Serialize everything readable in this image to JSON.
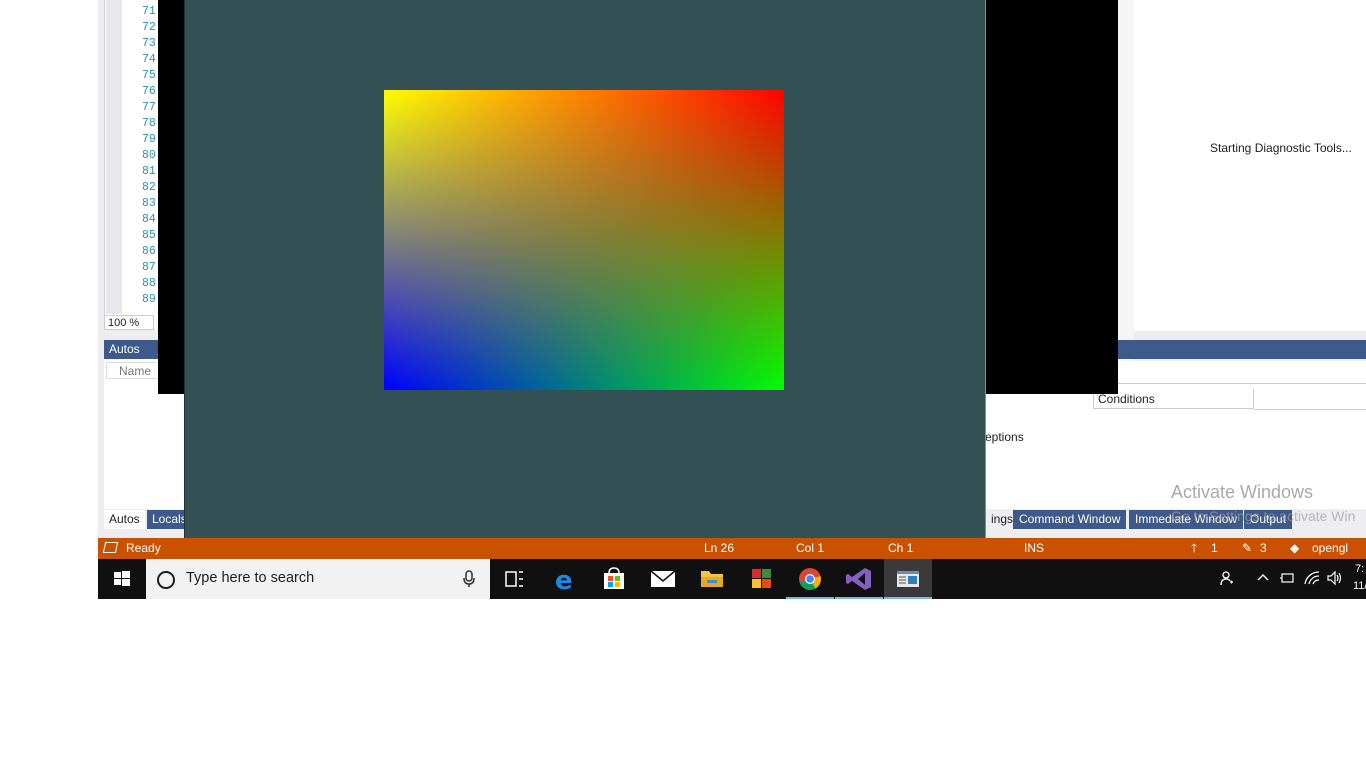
{
  "editor": {
    "line_numbers": [
      "71",
      "72",
      "73",
      "74",
      "75",
      "76",
      "77",
      "78",
      "79",
      "80",
      "81",
      "82",
      "83",
      "84",
      "85",
      "86",
      "87",
      "88",
      "89"
    ],
    "zoom_level": "100 %"
  },
  "diagnostics": {
    "status_text": "Starting Diagnostic Tools..."
  },
  "autos_panel": {
    "title": "Autos",
    "column_name": "Name",
    "tabs": [
      "Autos",
      "Locals"
    ]
  },
  "breakpoints_panel": {
    "column_conditions": "Conditions",
    "exceptions_partial": "eptions",
    "tabs": {
      "settings_partial": "ings",
      "command_window": "Command Window",
      "immediate_window": "Immediate Window",
      "output": "Output"
    }
  },
  "watermark": {
    "title": "Activate Windows",
    "subtitle": "Go to Settings to activate Win"
  },
  "gl_window": {
    "background_color": "#335055",
    "gradient_corners": {
      "top_left": "#ffff00",
      "top_right": "#ff0000",
      "bottom_left": "#0000ff",
      "bottom_right": "#00ff00"
    }
  },
  "statusbar": {
    "state": "Ready",
    "line": "Ln 26",
    "column": "Col 1",
    "char": "Ch 1",
    "mode": "INS",
    "pending_pushes": "1",
    "pending_changes": "3",
    "repo": "opengl",
    "color": "#ca5100"
  },
  "taskbar": {
    "search_placeholder": "Type here to search",
    "apps": [
      "task-view-icon",
      "edge-icon",
      "store-icon",
      "mail-icon",
      "file-explorer-icon",
      "app-tiles-icon",
      "chrome-icon",
      "visual-studio-icon",
      "console-window-icon"
    ],
    "clock_partial_time": "7:",
    "clock_partial_date": "11/"
  }
}
